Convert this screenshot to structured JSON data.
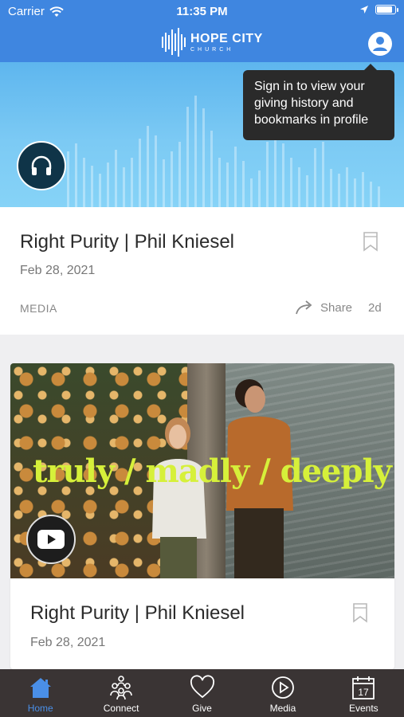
{
  "status_bar": {
    "carrier": "Carrier",
    "time": "11:35 PM"
  },
  "header": {
    "logo_line1": "HOPE CITY",
    "logo_line2": "CHURCH"
  },
  "tooltip": {
    "text": "Sign in to view your giving history and bookmarks in profile"
  },
  "colors": {
    "header": "#3f86e0",
    "tabbar": "#3a3434",
    "active_tab": "#4a8fe7",
    "overlay_text": "#d6f03a"
  },
  "feed": [
    {
      "title": "Right Purity | Phil Kniesel",
      "date": "Feb 28, 2021",
      "category": "MEDIA",
      "share_label": "Share",
      "age": "2d",
      "media_icon": "headphones-icon"
    },
    {
      "title": "Right Purity | Phil Kniesel",
      "date": "Feb 28, 2021",
      "image_text": "truly / madly / deeply",
      "media_icon": "youtube-icon"
    }
  ],
  "tabs": [
    {
      "label": "Home",
      "icon": "home-icon",
      "active": true
    },
    {
      "label": "Connect",
      "icon": "people-icon",
      "active": false
    },
    {
      "label": "Give",
      "icon": "heart-icon",
      "active": false
    },
    {
      "label": "Media",
      "icon": "play-circle-icon",
      "active": false
    },
    {
      "label": "Events",
      "icon": "calendar-icon",
      "active": false
    }
  ]
}
